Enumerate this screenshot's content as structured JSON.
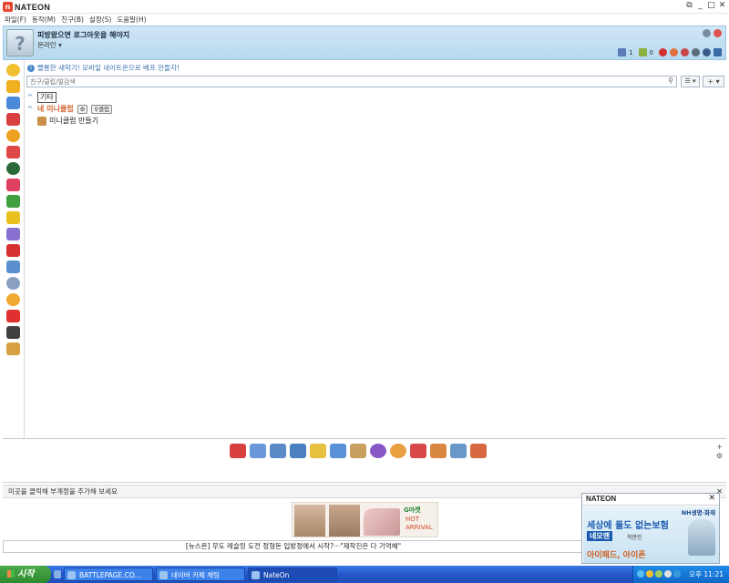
{
  "window": {
    "app_name": "NATEON",
    "controls": [
      "⧉",
      "_",
      "□",
      "✕"
    ]
  },
  "menu": {
    "items": [
      "파일(F)",
      "동작(M)",
      "친구(B)",
      "설정(S)",
      "도움말(H)"
    ]
  },
  "profile": {
    "status_message": "피방왔으면 로그아웃을 해야지",
    "presence": "온라인 ▾",
    "mail_count": "1",
    "memo_count": "0"
  },
  "notice": {
    "text": "빨롱한 새학기! 모바일 네이트온으로 베프 만들자!"
  },
  "search": {
    "placeholder": "친구/클럽/멀검색",
    "list_button": "☰ ▾",
    "add_button": "+ ▾"
  },
  "tree": {
    "group_etc": "기타",
    "group_club": "네 미니클럽",
    "club_badge": "클럽",
    "club_item": "미니클럽 만들기"
  },
  "hint": {
    "text": "미곳을 클릭해 부계정을 추가해 보세요"
  },
  "ad": {
    "brand": "G마켓",
    "headline_1": "HOT",
    "headline_2": "ARRIVAL"
  },
  "news": {
    "text": "[뉴스온] 무도 레슬링 도전 정형돈 입방정에서 시작?···\"제작진은 다 기억해\""
  },
  "popup": {
    "logo": "NATEON",
    "brand": "NH생명·화재",
    "headline": "세상에 둘도 없는보험",
    "tag": "네모맨",
    "sub": "착한인",
    "prize": "아이패드, 아이폰"
  },
  "taskbar": {
    "start_label": "시작",
    "tasks": [
      "BATTLEPAGE.CO...",
      "네이버 카페 채팅",
      "NateOn"
    ],
    "clock": "오후 11:21"
  }
}
